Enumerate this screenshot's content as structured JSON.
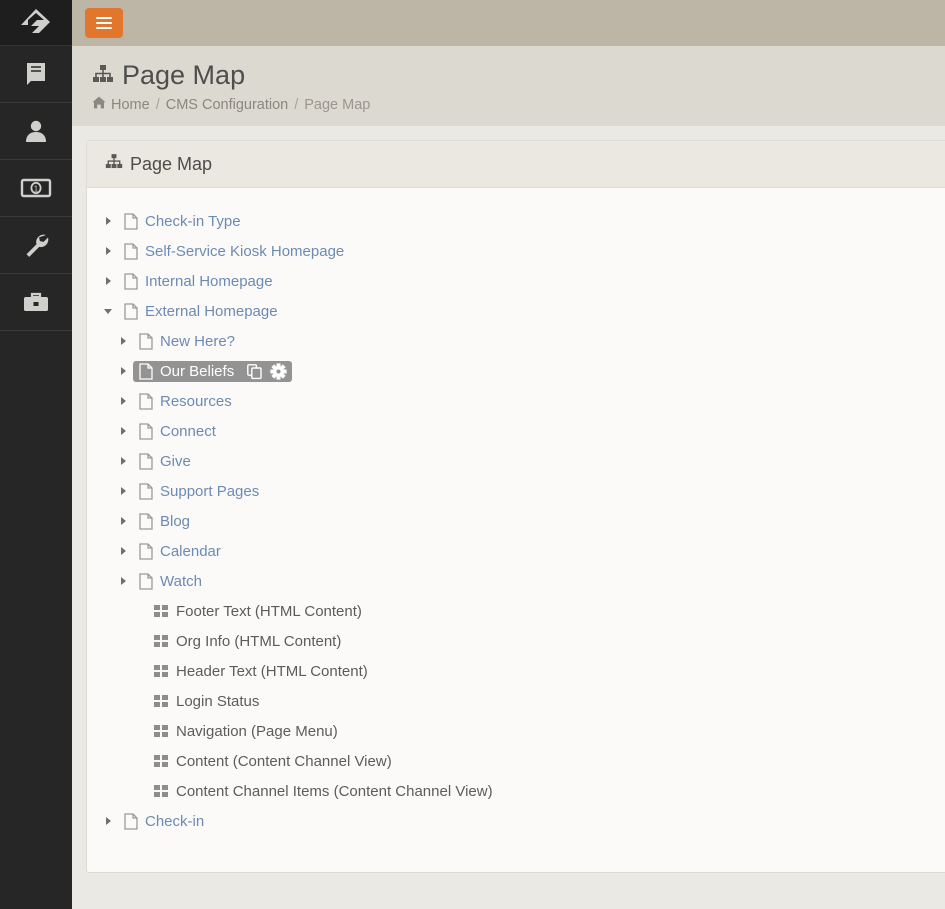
{
  "rail": {
    "logo": "rock-logo-icon",
    "items": [
      {
        "name": "book-icon"
      },
      {
        "name": "person-icon"
      },
      {
        "name": "money-bill-icon"
      },
      {
        "name": "wrench-icon"
      },
      {
        "name": "briefcase-icon"
      }
    ]
  },
  "topbar": {
    "menu_toggle_label": "",
    "menu_icon": "hamburger-icon",
    "accent_color": "#e2762c",
    "background_color": "#bdb6a6"
  },
  "header": {
    "title": "Page Map",
    "title_icon": "sitemap-icon",
    "breadcrumb": {
      "home_icon": "home-icon",
      "home": "Home",
      "sep1": "/",
      "section": "CMS Configuration",
      "sep2": "/",
      "current": "Page Map"
    }
  },
  "panel": {
    "title": "Page Map",
    "title_icon": "sitemap-icon"
  },
  "tree": {
    "items": [
      {
        "level": 0,
        "caret": "right",
        "icon": "file-icon",
        "label": "Check-in Type",
        "type": "page",
        "selected": false
      },
      {
        "level": 0,
        "caret": "right",
        "icon": "file-icon",
        "label": "Self-Service Kiosk Homepage",
        "type": "page",
        "selected": false
      },
      {
        "level": 0,
        "caret": "right",
        "icon": "file-icon",
        "label": "Internal Homepage",
        "type": "page",
        "selected": false
      },
      {
        "level": 0,
        "caret": "down",
        "icon": "file-icon",
        "label": "External Homepage",
        "type": "page",
        "selected": false
      },
      {
        "level": 1,
        "caret": "right",
        "icon": "file-icon",
        "label": "New Here?",
        "type": "page",
        "selected": false
      },
      {
        "level": 1,
        "caret": "right",
        "icon": "file-icon",
        "label": "Our Beliefs",
        "type": "page",
        "selected": true,
        "actions": [
          {
            "name": "copy-page-icon"
          },
          {
            "name": "gear-icon"
          }
        ]
      },
      {
        "level": 1,
        "caret": "right",
        "icon": "file-icon",
        "label": "Resources",
        "type": "page",
        "selected": false
      },
      {
        "level": 1,
        "caret": "right",
        "icon": "file-icon",
        "label": "Connect",
        "type": "page",
        "selected": false
      },
      {
        "level": 1,
        "caret": "right",
        "icon": "file-icon",
        "label": "Give",
        "type": "page",
        "selected": false
      },
      {
        "level": 1,
        "caret": "right",
        "icon": "file-icon",
        "label": "Support Pages",
        "type": "page",
        "selected": false
      },
      {
        "level": 1,
        "caret": "right",
        "icon": "file-icon",
        "label": "Blog",
        "type": "page",
        "selected": false
      },
      {
        "level": 1,
        "caret": "right",
        "icon": "file-icon",
        "label": "Calendar",
        "type": "page",
        "selected": false
      },
      {
        "level": 1,
        "caret": "right",
        "icon": "file-icon",
        "label": "Watch",
        "type": "page",
        "selected": false
      },
      {
        "level": 2,
        "caret": "none",
        "icon": "block-icon",
        "label": "Footer Text (HTML Content)",
        "type": "block",
        "selected": false
      },
      {
        "level": 2,
        "caret": "none",
        "icon": "block-icon",
        "label": "Org Info (HTML Content)",
        "type": "block",
        "selected": false
      },
      {
        "level": 2,
        "caret": "none",
        "icon": "block-icon",
        "label": "Header Text (HTML Content)",
        "type": "block",
        "selected": false
      },
      {
        "level": 2,
        "caret": "none",
        "icon": "block-icon",
        "label": "Login Status",
        "type": "block",
        "selected": false
      },
      {
        "level": 2,
        "caret": "none",
        "icon": "block-icon",
        "label": "Navigation (Page Menu)",
        "type": "block",
        "selected": false
      },
      {
        "level": 2,
        "caret": "none",
        "icon": "block-icon",
        "label": "Content (Content Channel View)",
        "type": "block",
        "selected": false
      },
      {
        "level": 2,
        "caret": "none",
        "icon": "block-icon",
        "label": "Content Channel Items (Content Channel View)",
        "type": "block",
        "selected": false
      },
      {
        "level": 0,
        "caret": "right",
        "icon": "file-icon",
        "label": "Check-in",
        "type": "page",
        "selected": false
      }
    ]
  },
  "colors": {
    "link": "#6c8bb4",
    "selected_bg": "#939393",
    "panel_bg": "#fbfaf8",
    "content_bg": "#ebe9e3"
  }
}
